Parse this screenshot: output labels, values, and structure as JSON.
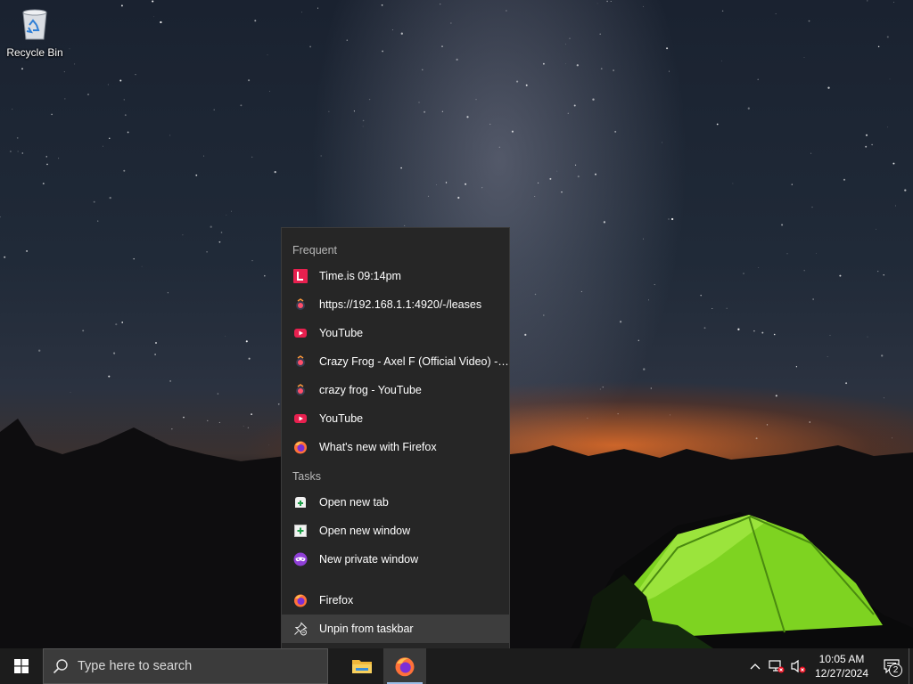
{
  "desktop": {
    "icons": [
      {
        "label": "Recycle Bin",
        "icon": "recycle-bin-icon"
      }
    ]
  },
  "jumplist": {
    "frequent_header": "Frequent",
    "frequent": [
      {
        "label": "Time.is 09:14pm",
        "icon": "timeis-icon"
      },
      {
        "label": "https://192.168.1.1:4920/-/leases",
        "icon": "firefox-page-icon"
      },
      {
        "label": "YouTube",
        "icon": "youtube-icon"
      },
      {
        "label": "Crazy Frog - Axel F (Official Video) - Yo...",
        "icon": "firefox-page-icon"
      },
      {
        "label": "crazy frog - YouTube",
        "icon": "firefox-page-icon"
      },
      {
        "label": "YouTube",
        "icon": "youtube-icon"
      },
      {
        "label": "What's new with Firefox",
        "icon": "firefox-icon"
      }
    ],
    "tasks_header": "Tasks",
    "tasks": [
      {
        "label": "Open new tab",
        "icon": "new-tab-icon"
      },
      {
        "label": "Open new window",
        "icon": "new-window-icon"
      },
      {
        "label": "New private window",
        "icon": "private-window-icon"
      }
    ],
    "app": {
      "label": "Firefox",
      "icon": "firefox-icon"
    },
    "unpin": {
      "label": "Unpin from taskbar",
      "icon": "unpin-icon"
    }
  },
  "taskbar": {
    "search_placeholder": "Type here to search",
    "apps": [
      {
        "name": "File Explorer",
        "icon": "file-explorer-icon",
        "active": false
      },
      {
        "name": "Firefox",
        "icon": "firefox-icon",
        "active": true
      }
    ],
    "clock": {
      "time": "10:05 AM",
      "date": "12/27/2024"
    },
    "notification_count": "2"
  },
  "colors": {
    "taskbar": "#1c1c1c",
    "jumplist_bg": "#262626",
    "youtube_red": "#e8204f",
    "firefox_orange": "#ff7139",
    "private_purple": "#8f3fd6"
  }
}
